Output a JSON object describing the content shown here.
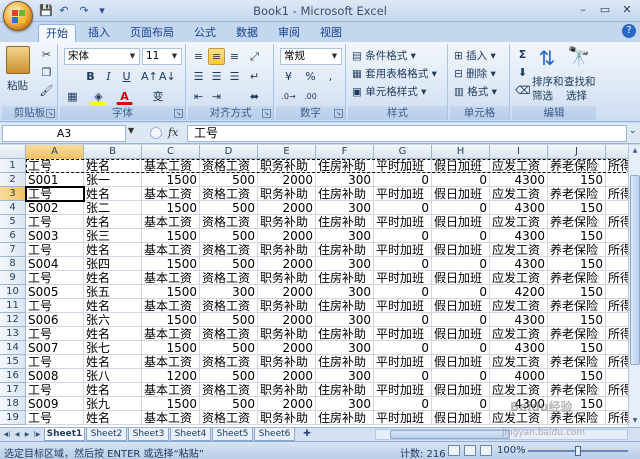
{
  "window": {
    "title": "Book1 - Microsoft Excel",
    "controls": [
      "–",
      "▭",
      "✕"
    ]
  },
  "ribbon": {
    "tabs": [
      "开始",
      "插入",
      "页面布局",
      "公式",
      "数据",
      "审阅",
      "视图"
    ],
    "active_tab": "开始",
    "clipboard": {
      "label": "剪贴板",
      "paste": "粘贴"
    },
    "font": {
      "label": "字体",
      "name": "宋体",
      "size": "11",
      "bold": "B",
      "italic": "I",
      "underline": "U",
      "font_color": "A",
      "phonetic": "变"
    },
    "alignment": {
      "label": "对齐方式"
    },
    "number": {
      "label": "数字",
      "format": "常规",
      "percent": "%",
      "comma": ","
    },
    "styles": {
      "label": "样式",
      "conditional": "条件格式",
      "table": "套用表格格式",
      "cell": "单元格样式"
    },
    "cells": {
      "label": "单元格",
      "insert": "插入",
      "delete": "删除",
      "format": "格式"
    },
    "editing": {
      "label": "编辑",
      "sum": "Σ",
      "sort": "排序和",
      "sort2": "筛选",
      "find": "查找和",
      "find2": "选择"
    }
  },
  "formula_bar": {
    "name_box": "A3",
    "fx": "fx",
    "value": "工号"
  },
  "grid": {
    "columns": [
      "A",
      "B",
      "C",
      "D",
      "E",
      "F",
      "G",
      "H",
      "I",
      "J",
      ""
    ],
    "rows": [
      [
        "工号",
        "姓名",
        "基本工资",
        "资格工资",
        "职务补助",
        "住房补助",
        "平时加班",
        "假日加班",
        "应发工资",
        "养老保险",
        "所得"
      ],
      [
        "S001",
        "张一",
        "1500",
        "500",
        "2000",
        "300",
        "0",
        "0",
        "4300",
        "150",
        ""
      ],
      [
        "工号",
        "姓名",
        "基本工资",
        "资格工资",
        "职务补助",
        "住房补助",
        "平时加班",
        "假日加班",
        "应发工资",
        "养老保险",
        "所得"
      ],
      [
        "S002",
        "张二",
        "1500",
        "500",
        "2000",
        "300",
        "0",
        "0",
        "4300",
        "150",
        ""
      ],
      [
        "工号",
        "姓名",
        "基本工资",
        "资格工资",
        "职务补助",
        "住房补助",
        "平时加班",
        "假日加班",
        "应发工资",
        "养老保险",
        "所得"
      ],
      [
        "S003",
        "张三",
        "1500",
        "500",
        "2000",
        "300",
        "0",
        "0",
        "4300",
        "150",
        ""
      ],
      [
        "工号",
        "姓名",
        "基本工资",
        "资格工资",
        "职务补助",
        "住房补助",
        "平时加班",
        "假日加班",
        "应发工资",
        "养老保险",
        "所得"
      ],
      [
        "S004",
        "张四",
        "1500",
        "500",
        "2000",
        "300",
        "0",
        "0",
        "4300",
        "150",
        ""
      ],
      [
        "工号",
        "姓名",
        "基本工资",
        "资格工资",
        "职务补助",
        "住房补助",
        "平时加班",
        "假日加班",
        "应发工资",
        "养老保险",
        "所得"
      ],
      [
        "S005",
        "张五",
        "1500",
        "300",
        "2000",
        "300",
        "0",
        "0",
        "4200",
        "150",
        ""
      ],
      [
        "工号",
        "姓名",
        "基本工资",
        "资格工资",
        "职务补助",
        "住房补助",
        "平时加班",
        "假日加班",
        "应发工资",
        "养老保险",
        "所得"
      ],
      [
        "S006",
        "张六",
        "1500",
        "500",
        "2000",
        "300",
        "0",
        "0",
        "4300",
        "150",
        ""
      ],
      [
        "工号",
        "姓名",
        "基本工资",
        "资格工资",
        "职务补助",
        "住房补助",
        "平时加班",
        "假日加班",
        "应发工资",
        "养老保险",
        "所得"
      ],
      [
        "S007",
        "张七",
        "1500",
        "500",
        "2000",
        "300",
        "0",
        "0",
        "4300",
        "150",
        ""
      ],
      [
        "工号",
        "姓名",
        "基本工资",
        "资格工资",
        "职务补助",
        "住房补助",
        "平时加班",
        "假日加班",
        "应发工资",
        "养老保险",
        "所得"
      ],
      [
        "S008",
        "张八",
        "1200",
        "500",
        "2000",
        "300",
        "0",
        "0",
        "4000",
        "150",
        ""
      ],
      [
        "工号",
        "姓名",
        "基本工资",
        "资格工资",
        "职务补助",
        "住房补助",
        "平时加班",
        "假日加班",
        "应发工资",
        "养老保险",
        "所得"
      ],
      [
        "S009",
        "张九",
        "1500",
        "500",
        "2000",
        "300",
        "0",
        "0",
        "4300",
        "150",
        ""
      ],
      [
        "工号",
        "姓名",
        "基本工资",
        "资格工资",
        "职务补助",
        "住房补助",
        "平时加班",
        "假日加班",
        "应发工资",
        "养老保险",
        "所得"
      ]
    ]
  },
  "sheets": [
    "Sheet1",
    "Sheet2",
    "Sheet3",
    "Sheet4",
    "Sheet5",
    "Sheet6"
  ],
  "active_sheet": "Sheet1",
  "status": {
    "message": "选定目标区域，然后按 ENTER 或选择“粘贴”",
    "count": "计数: 216",
    "zoom": "100%"
  },
  "watermark": {
    "line1": "Baidu经验",
    "line2": "jingyan.baidu.com"
  }
}
